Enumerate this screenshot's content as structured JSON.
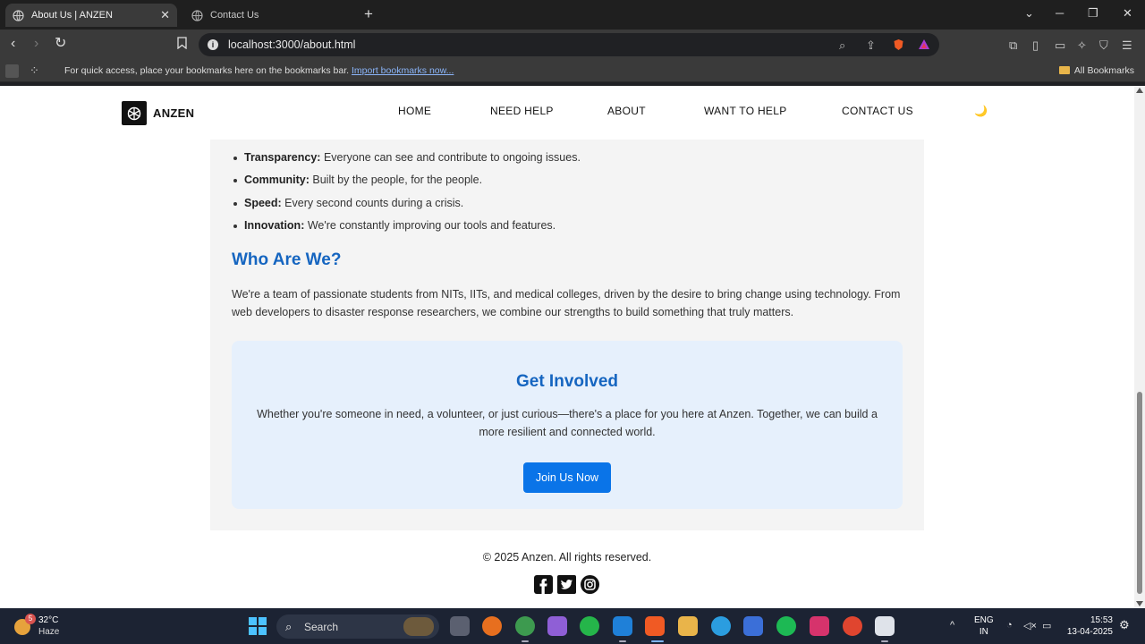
{
  "browser": {
    "tabs": [
      {
        "title": "About Us | ANZEN",
        "active": true
      },
      {
        "title": "Contact Us",
        "active": false
      }
    ],
    "url": "localhost:3000/about.html",
    "bookmarks_bar": {
      "message": "For quick access, place your bookmarks here on the bookmarks bar.",
      "import_link": "Import bookmarks now...",
      "all_bookmarks": "All Bookmarks"
    }
  },
  "site": {
    "logo_text": "ANZEN",
    "nav": [
      "HOME",
      "NEED HELP",
      "ABOUT",
      "WANT TO HELP",
      "CONTACT US"
    ],
    "theme_toggle_icon": "moon-icon"
  },
  "values": [
    {
      "label": "Transparency:",
      "text": " Everyone can see and contribute to ongoing issues."
    },
    {
      "label": "Community:",
      "text": " Built by the people, for the people."
    },
    {
      "label": "Speed:",
      "text": " Every second counts during a crisis."
    },
    {
      "label": "Innovation:",
      "text": " We're constantly improving our tools and features."
    }
  ],
  "who": {
    "title": "Who Are We?",
    "text": "We're a team of passionate students from NITs, IITs, and medical colleges, driven by the desire to bring change using technology. From web developers to disaster response researchers, we combine our strengths to build something that truly matters."
  },
  "involved": {
    "title": "Get Involved",
    "text": "Whether you're someone in need, a volunteer, or just curious—there's a place for you here at Anzen. Together, we can build a more resilient and connected world.",
    "button": "Join Us Now"
  },
  "footer": {
    "copyright": "© 2025 Anzen. All rights reserved.",
    "socials": [
      "facebook-icon",
      "twitter-icon",
      "instagram-icon"
    ]
  },
  "colors": {
    "accent": "#1565c0",
    "button": "#0a74e8",
    "card_bg": "#e6f0fc",
    "section_bg": "#f4f4f4"
  },
  "taskbar": {
    "weather_badge": "5",
    "temperature": "32°C",
    "condition": "Haze",
    "search_label": "Search",
    "language": "ENG",
    "region": "IN",
    "time": "15:53",
    "date": "13-04-2025"
  }
}
